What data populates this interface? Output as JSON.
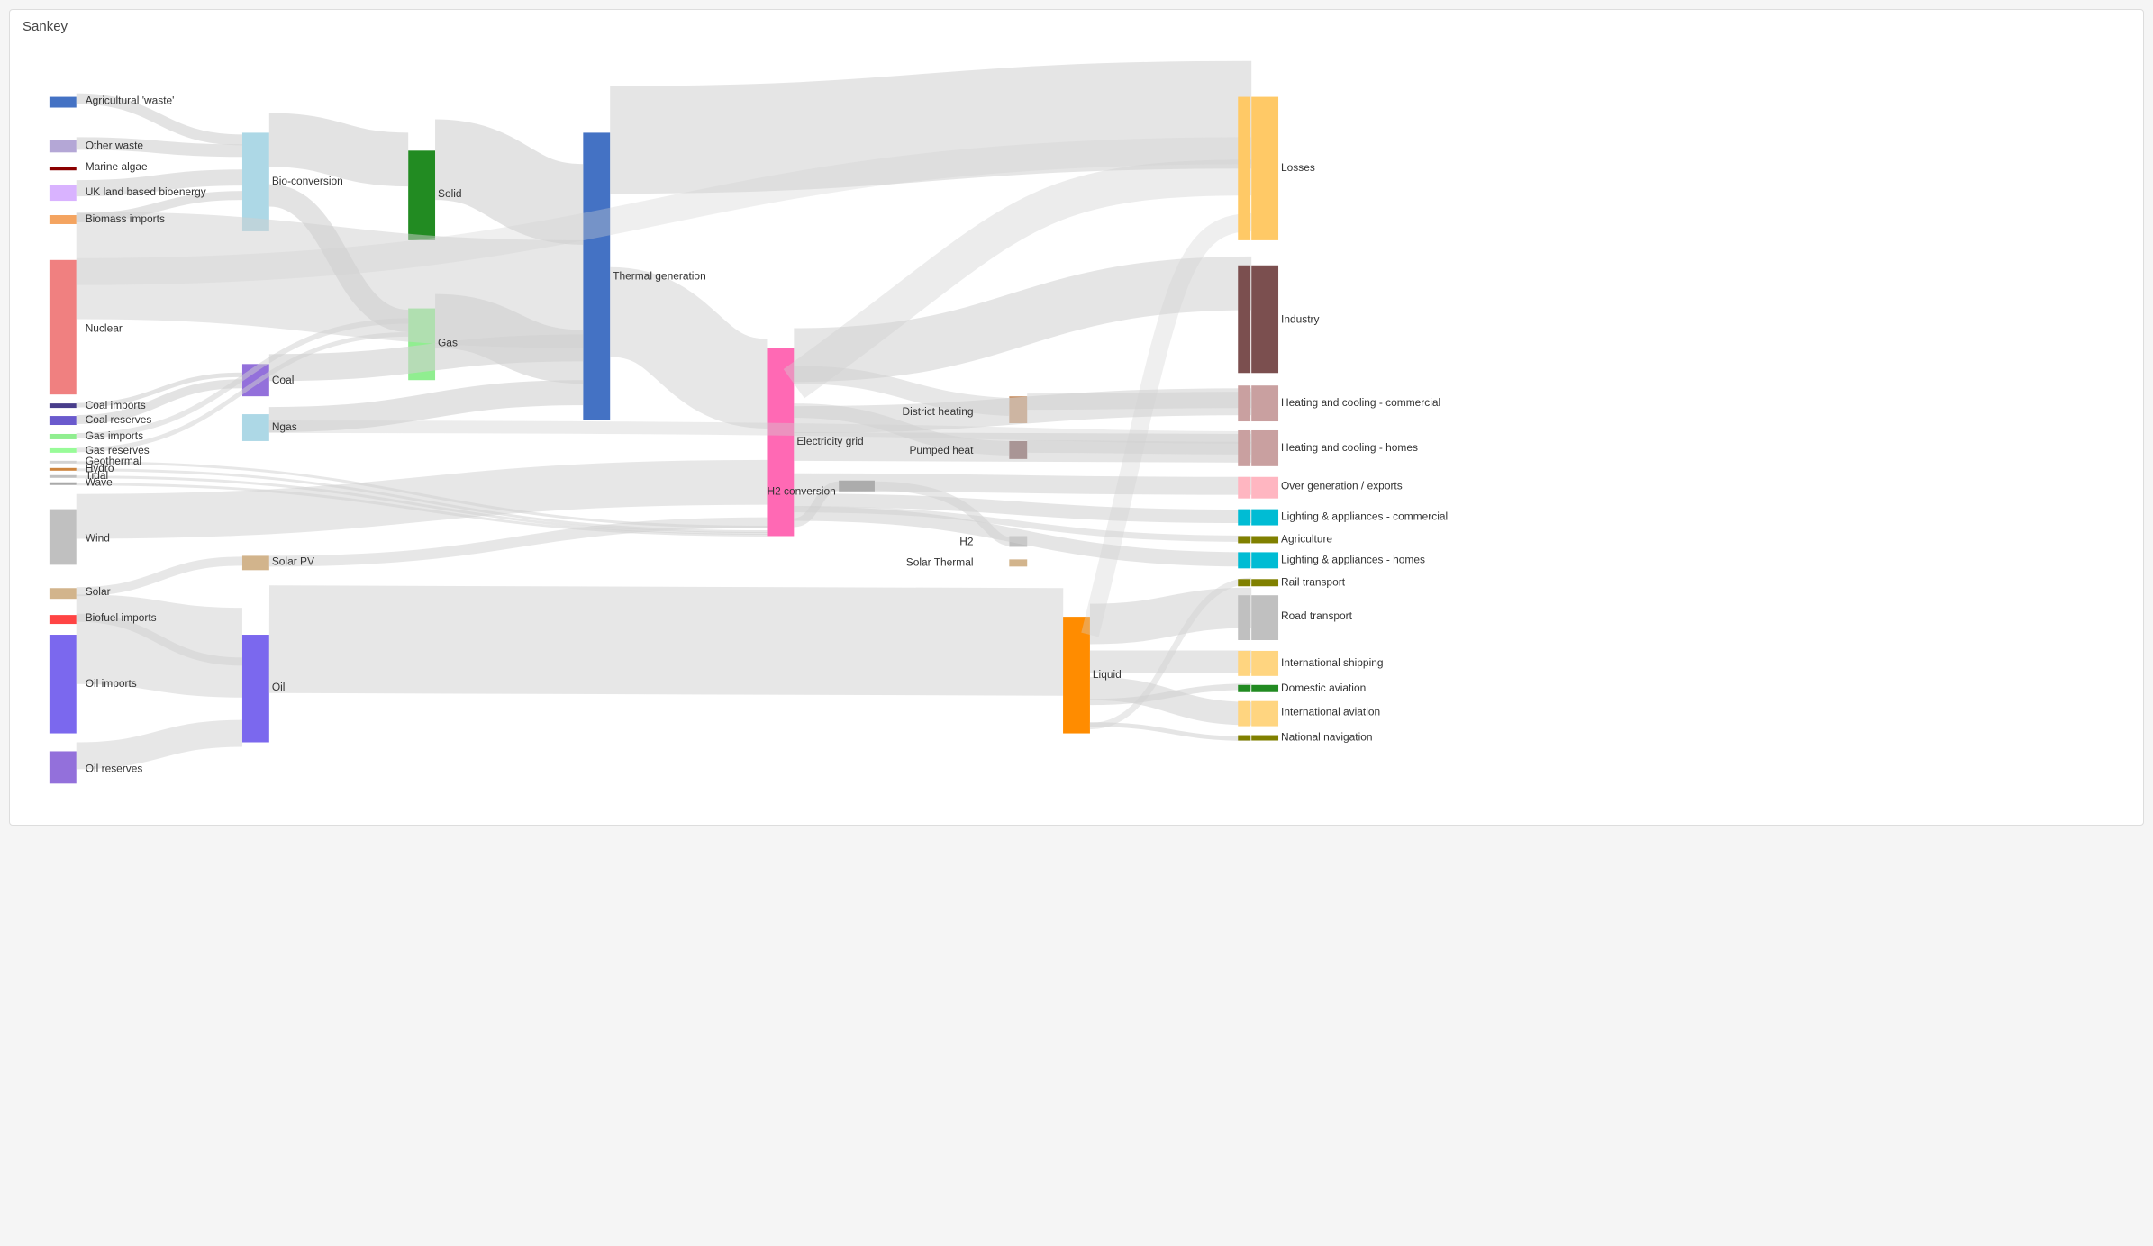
{
  "title": "Sankey",
  "colors": {
    "agricultural_waste": "#4472c4",
    "other_waste": "#b4a7d6",
    "marine_algae": "#8b0000",
    "uk_land": "#d9b3ff",
    "biomass_imports": "#f4a460",
    "nuclear": "#f08080",
    "coal_imports": "#483d8b",
    "coal_reserves": "#6a5acd",
    "gas_imports": "#90ee90",
    "gas_reserves": "#98fb98",
    "geothermal": "#d3d3d3",
    "hydro": "#cd853f",
    "tidal": "#c0c0c0",
    "wave": "#a9a9a9",
    "wind": "#c0c0c0",
    "solar": "#d2b48c",
    "biofuel_imports": "#ff4444",
    "oil_imports": "#7b68ee",
    "oil_reserves": "#9370db",
    "bio_conversion": "#add8e6",
    "solid": "#228b22",
    "gas_node": "#90ee90",
    "coal_node": "#9370db",
    "ngas_node": "#add8e6",
    "solar_pv": "#d2b48c",
    "oil_node": "#7b68ee",
    "thermal_gen": "#4472c4",
    "electricity_grid": "#ff69b4",
    "h2_conversion": "#808080",
    "liquid": "#ff8c00",
    "losses": "#ffc966",
    "industry": "#7b4f4f",
    "district_heating": "#c9956c",
    "heating_commercial": "#c9a0a0",
    "heating_homes": "#c9a0a0",
    "pumped_heat": "#7b4f4f",
    "over_gen": "#ffb6c1",
    "lighting_commercial": "#00bcd4",
    "agriculture": "#808000",
    "solar_thermal": "#d2b48c",
    "lighting_homes": "#00bcd4",
    "rail": "#808000",
    "road": "#c0c0c0",
    "intl_shipping": "#ffd580",
    "domestic_aviation": "#228b22",
    "intl_aviation": "#ffd580",
    "national_nav": "#808000",
    "h2": "#c0c0c0",
    "link": "#d0d0d0"
  },
  "left_legend": [
    {
      "label": "Agricultural 'waste'",
      "color": "#4472c4"
    },
    {
      "label": "Other waste",
      "color": "#b4a7d6"
    },
    {
      "label": "Marine algae",
      "color": "#8b0000"
    },
    {
      "label": "UK land based bioenergy",
      "color": "#d9b3ff"
    },
    {
      "label": "Biomass imports",
      "color": "#f4a460"
    },
    {
      "label": "Nuclear",
      "color": ""
    },
    {
      "label": "Coal imports",
      "color": "#483d8b"
    },
    {
      "label": "Coal reserves",
      "color": "#6a5acd"
    },
    {
      "label": "Gas imports",
      "color": "#90ee90"
    },
    {
      "label": "Gas reserves",
      "color": "#98fb98"
    },
    {
      "label": "Geothermal",
      "color": "#d3d3d3"
    },
    {
      "label": "Hydro",
      "color": "#cd853f"
    },
    {
      "label": "Tidal",
      "color": "#c0c0c0"
    },
    {
      "label": "Wave",
      "color": "#a9a9a9"
    },
    {
      "label": "Wind",
      "color": ""
    },
    {
      "label": "Solar",
      "color": "#d2b48c"
    },
    {
      "label": "Biofuel imports",
      "color": "#ff4444"
    },
    {
      "label": "Oil imports",
      "color": ""
    },
    {
      "label": "Oil reserves",
      "color": "#9370db"
    }
  ],
  "right_legend": [
    {
      "label": "Losses",
      "color": "#ffc966"
    },
    {
      "label": "Industry",
      "color": "#7b4f4f"
    },
    {
      "label": "Heating and cooling - commercial",
      "color": "#c9a0a0"
    },
    {
      "label": "Heating and cooling - homes",
      "color": "#c9a0a0"
    },
    {
      "label": "Over generation / exports",
      "color": "#ffb6c1"
    },
    {
      "label": "Lighting & appliances - commercial",
      "color": "#00bcd4"
    },
    {
      "label": "Agriculture",
      "color": "#808000"
    },
    {
      "label": "Lighting & appliances - homes",
      "color": "#00bcd4"
    },
    {
      "label": "Rail transport",
      "color": "#808000"
    },
    {
      "label": "Road transport",
      "color": "#c0c0c0"
    },
    {
      "label": "International shipping",
      "color": "#ffd580"
    },
    {
      "label": "Domestic aviation",
      "color": "#228b22"
    },
    {
      "label": "International aviation",
      "color": "#ffd580"
    },
    {
      "label": "National navigation",
      "color": "#808000"
    }
  ]
}
